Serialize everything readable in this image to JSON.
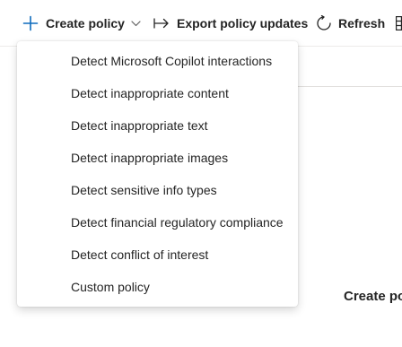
{
  "toolbar": {
    "create_policy_label": "Create policy",
    "export_label": "Export policy updates",
    "refresh_label": "Refresh"
  },
  "menu": {
    "items": [
      {
        "label": "Detect Microsoft Copilot interactions"
      },
      {
        "label": "Detect inappropriate content"
      },
      {
        "label": "Detect inappropriate text"
      },
      {
        "label": "Detect inappropriate images"
      },
      {
        "label": "Detect sensitive info types"
      },
      {
        "label": "Detect financial regulatory compliance"
      },
      {
        "label": "Detect conflict of interest"
      },
      {
        "label": "Custom policy"
      }
    ]
  },
  "background": {
    "heading": "Create po"
  },
  "colors": {
    "text": "#242424",
    "divider": "#e1dfdd"
  },
  "icons": [
    "add-icon",
    "chevron-down-icon",
    "export-arrow-icon",
    "refresh-icon",
    "more-icon"
  ]
}
